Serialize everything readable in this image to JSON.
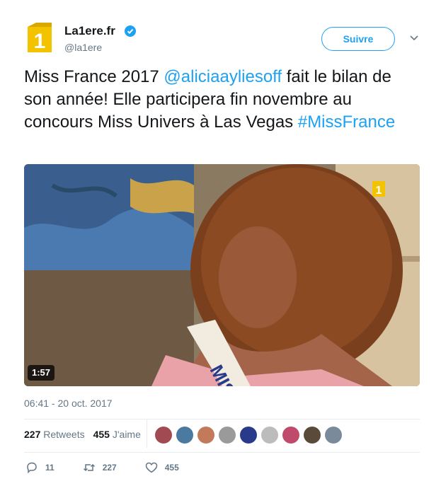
{
  "account": {
    "display_name": "La1ere.fr",
    "handle": "@la1ere",
    "verified_icon": "verified-badge-icon"
  },
  "follow_button": {
    "label": "Suivre"
  },
  "tweet": {
    "text_part1": "Miss France 2017 ",
    "mention": "@aliciaayliesoff",
    "text_part2": " fait le bilan de son année! Elle participera fin novembre au concours Miss Univers à Las Vegas ",
    "hashtag": "#MissFrance"
  },
  "media": {
    "duration": "1:57",
    "sash_text": "MISS"
  },
  "timestamp": "06:41 - 20 oct. 2017",
  "stats": {
    "retweets_count": "227",
    "retweets_label": "Retweets",
    "likes_count": "455",
    "likes_label": "J'aime"
  },
  "avatars": [
    {
      "color": "#a24a52"
    },
    {
      "color": "#4a7aa0"
    },
    {
      "color": "#c27a5a"
    },
    {
      "color": "#9a9a9a"
    },
    {
      "color": "#2a3a8a"
    },
    {
      "color": "#bcbcbc"
    },
    {
      "color": "#c04a6a"
    },
    {
      "color": "#5a4a3a"
    },
    {
      "color": "#7a8a9a"
    }
  ],
  "actions": {
    "reply_count": "11",
    "retweet_count": "227",
    "like_count": "455"
  },
  "colors": {
    "accent": "#1da1f2",
    "text": "#14171a",
    "muted": "#657786",
    "brand_yellow": "#f3c300"
  }
}
